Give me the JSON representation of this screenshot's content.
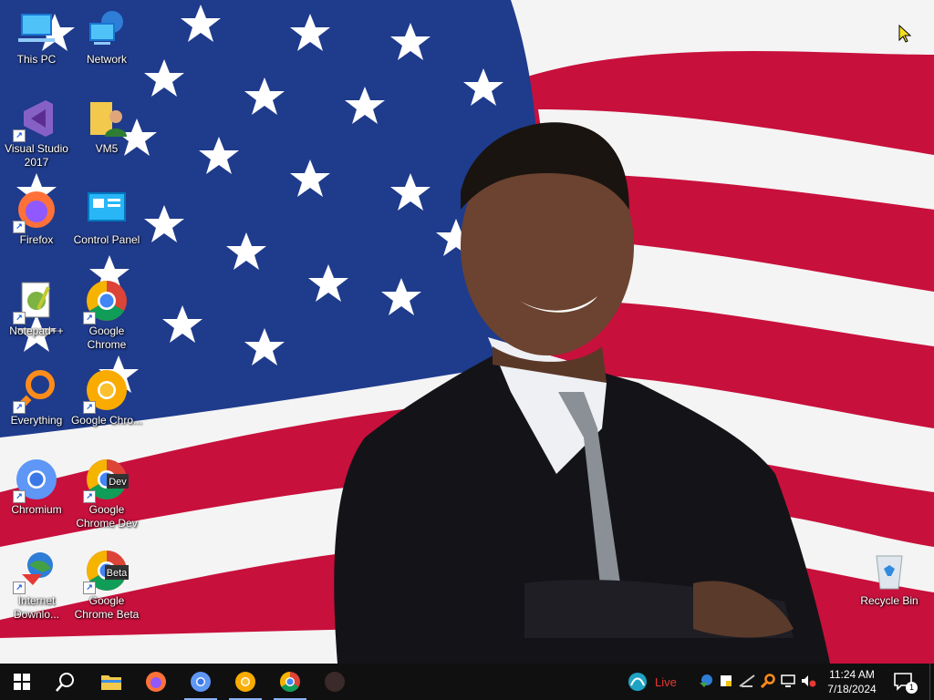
{
  "desktop": {
    "icons": [
      {
        "label": "This PC"
      },
      {
        "label": "Network"
      },
      {
        "label": "Visual Studio 2017"
      },
      {
        "label": "VM5"
      },
      {
        "label": "Firefox"
      },
      {
        "label": "Control Panel"
      },
      {
        "label": "Notepad++"
      },
      {
        "label": "Google Chrome"
      },
      {
        "label": "Everything"
      },
      {
        "label": "Google Chro..."
      },
      {
        "label": "Chromium"
      },
      {
        "label": "Google Chrome Dev"
      },
      {
        "label": "Internet Downlo..."
      },
      {
        "label": "Google Chrome Beta"
      },
      {
        "label": "Recycle Bin"
      }
    ],
    "badges": {
      "dev": "Dev",
      "beta": "Beta"
    }
  },
  "taskbar": {
    "weather_label": "Live",
    "time": "11:24 AM",
    "date": "7/18/2024",
    "notification_count": "1"
  },
  "colors": {
    "taskbar": "#101010",
    "flag_blue": "#1f3b8c",
    "flag_red": "#c8103c"
  }
}
